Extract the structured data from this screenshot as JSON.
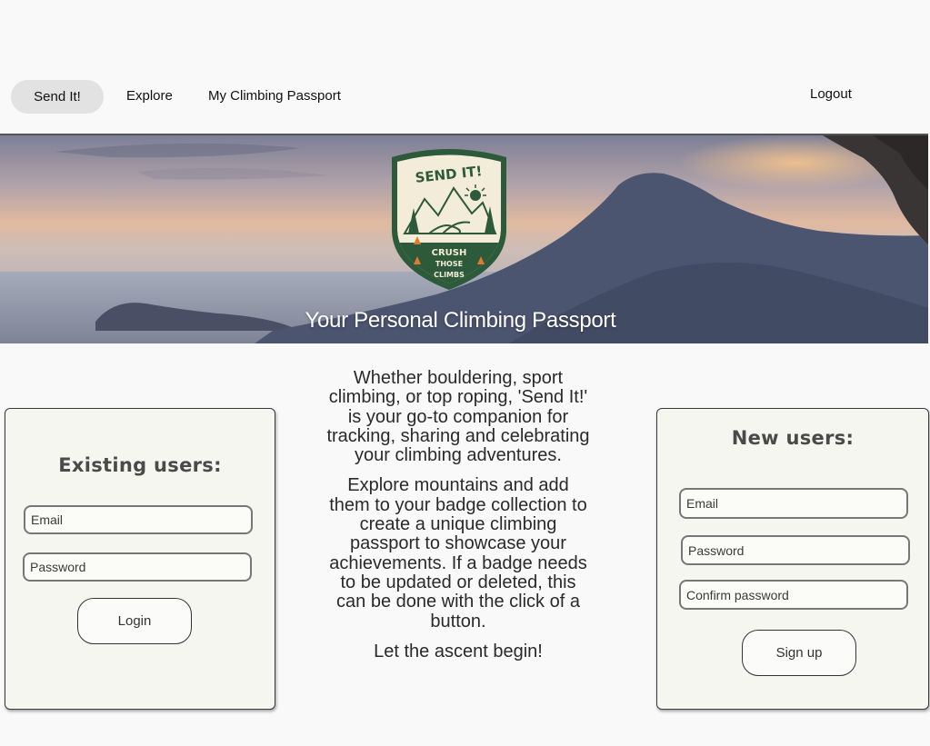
{
  "nav": {
    "brand": "Send It!",
    "explore": "Explore",
    "passport": "My Climbing Passport",
    "logout": "Logout"
  },
  "hero": {
    "title": "Your Personal Climbing Passport",
    "badge": {
      "top_text": "SEND IT!",
      "lines": [
        "CRUSH",
        "THOSE",
        "CLIMBS"
      ]
    }
  },
  "intro": {
    "p1": "Whether bouldering, sport climbing, or top roping, 'Send It!' is your go-to companion for tracking, sharing and celebrating your climbing adventures.",
    "p2": "Explore mountains and add them to your badge collection to create a unique climbing passport to showcase your achievements. If a badge needs to be updated or deleted, this can be done with the click of a button.",
    "p3": "Let the ascent begin!"
  },
  "login": {
    "heading": "Existing users:",
    "email_placeholder": "Email",
    "password_placeholder": "Password",
    "button": "Login"
  },
  "signup": {
    "heading": "New users:",
    "email_placeholder": "Email",
    "password_placeholder": "Password",
    "confirm_placeholder": "Confirm password",
    "button": "Sign up"
  },
  "colors": {
    "badge_green": "#2d5a3a",
    "badge_cream": "#f3ecd9",
    "card_bg": "#f6f6f1",
    "nav_pill": "#e2e2e2"
  }
}
